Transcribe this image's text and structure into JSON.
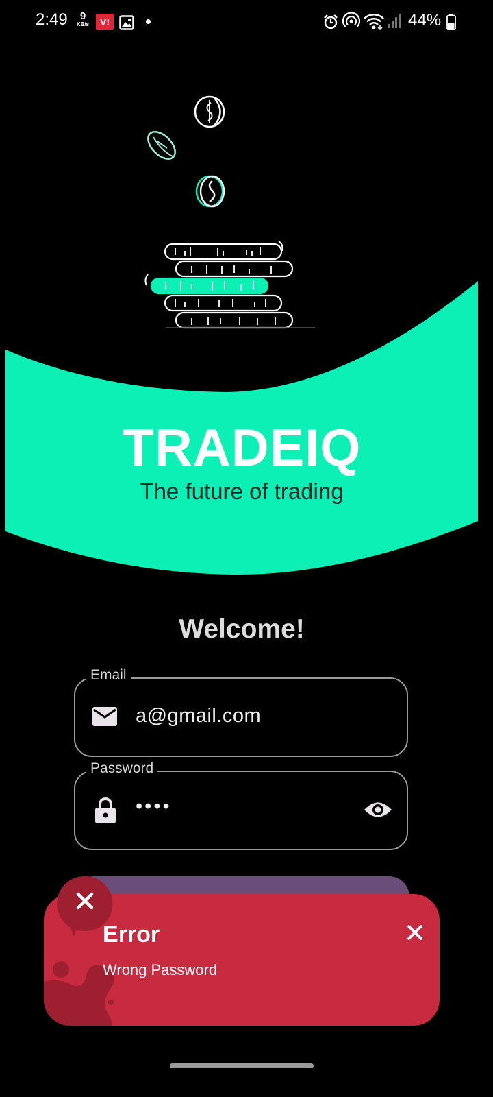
{
  "status_bar": {
    "time": "2:49",
    "net_speed_value": "9",
    "net_speed_unit": "KB/s",
    "carrier_badge": "V!",
    "battery": "44%",
    "icons": [
      "gallery-icon",
      "alarm-icon",
      "hotspot-icon",
      "wifi-icon",
      "signal-icon",
      "battery-icon"
    ]
  },
  "hero": {
    "illustration": "coins-stack-illustration",
    "title": "TRADEIQ",
    "subtitle": "The future of trading"
  },
  "welcome": "Welcome!",
  "email": {
    "label": "Email",
    "value": "a@gmail.com",
    "icon": "mail-icon"
  },
  "password": {
    "label": "Password",
    "value": "••••",
    "icon": "lock-icon",
    "toggle_icon": "eye-icon"
  },
  "toast": {
    "title": "Error",
    "message": "Wrong Password",
    "icon": "close-icon"
  },
  "colors": {
    "accent": "#0cf0b6",
    "background": "#000000",
    "error": "#c82a3f",
    "error_dark": "#9e1f30",
    "button": "#6b4d7a"
  }
}
